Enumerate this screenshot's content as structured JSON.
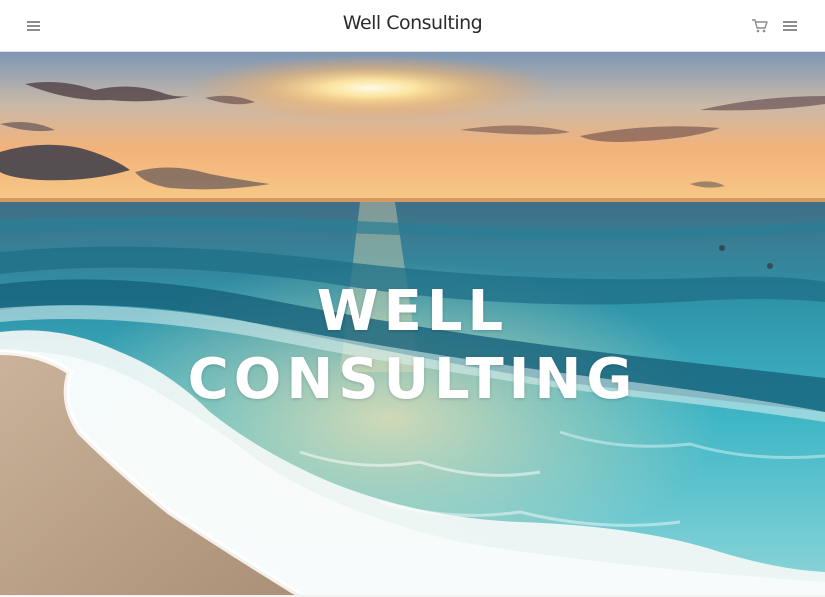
{
  "header": {
    "brand": "Well Consulting",
    "icons": {
      "menu_left": "hamburger-menu-icon",
      "cart": "shopping-cart-icon",
      "menu_right": "hamburger-menu-icon"
    },
    "icon_color": "#8c8c8c"
  },
  "hero": {
    "title_line1": "WELL",
    "title_line2": "CONSULTING",
    "background": "sunset-beach-waves",
    "title_color": "#ffffff"
  }
}
